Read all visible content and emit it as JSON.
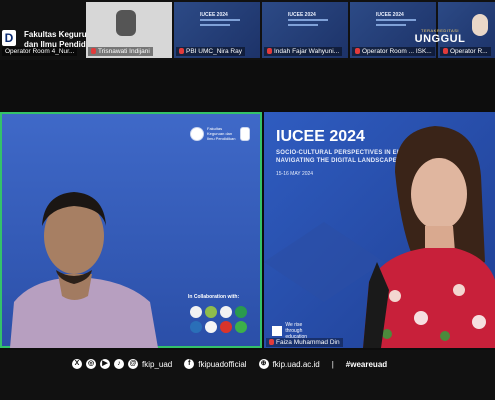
{
  "header": {
    "faculty_logo_letter": "D",
    "faculty_name_line1": "Fakultas Keguruan",
    "faculty_name_line2": "dan Ilmu Pendidikan",
    "unggul_small": "TERAKREDITASI",
    "unggul_big": "UNGGUL"
  },
  "participants": [
    {
      "label": "Operator Room 4_Nur..."
    },
    {
      "label": "Trisnawati Indijani"
    },
    {
      "label": "PBI UMC_Nira Ray"
    },
    {
      "label": "Indah Fajar Wahyuni..."
    },
    {
      "label": "Operator Room ... ISK..."
    },
    {
      "label": "Operator R..."
    }
  ],
  "left_video": {
    "partner_text": "Fakultas Keguruan dan Ilmu Pendidikan",
    "collab_title": "In Collaboration with:"
  },
  "right_video": {
    "title": "IUCEE 2024",
    "subtitle_line1": "SOCIO-CULTURAL PERSPECTIVES IN ELT:",
    "subtitle_line2": "NAVIGATING THE DIGITAL LANDSCAPES",
    "date": "15-16 MAY 2024",
    "logo_line1": "We rise",
    "logo_line2": "through",
    "logo_line3": "education",
    "speaker": "Faiza Muhammad Din"
  },
  "footer": {
    "handle1": "fkip_uad",
    "handle2": "fkipuadofficial",
    "website": "fkip.uad.ac.id",
    "hashtag": "#weareuad"
  },
  "colors": {
    "active_speaker_border": "#34c26a",
    "slide_blue": "#3458b6",
    "muted_mic": "#e23b3b"
  }
}
